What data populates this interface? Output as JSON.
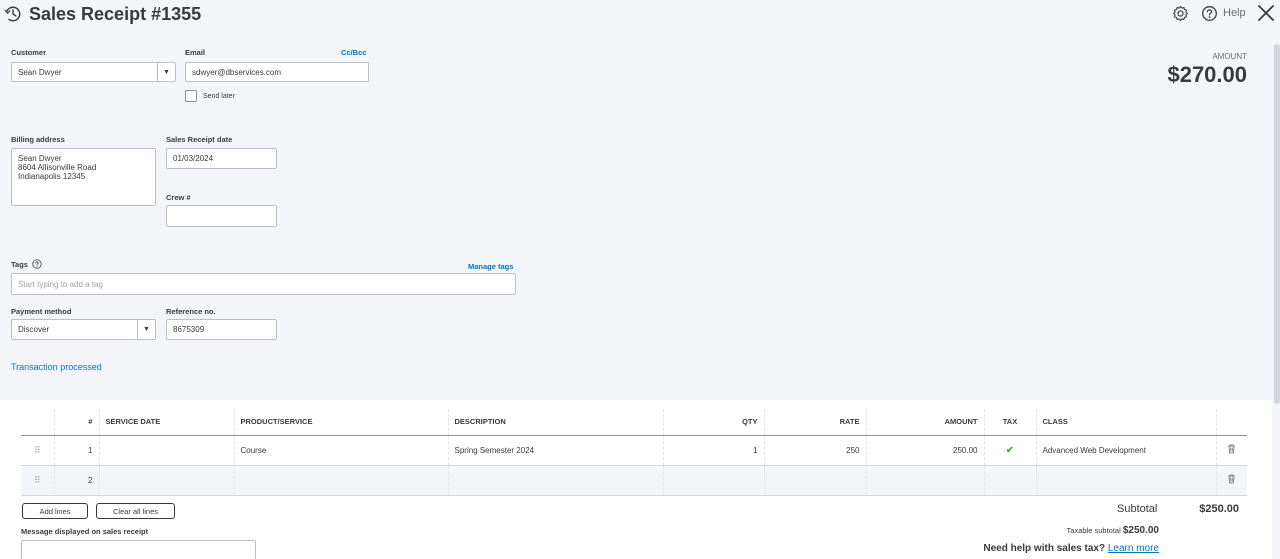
{
  "header": {
    "title": "Sales Receipt #1355",
    "help_label": "Help"
  },
  "form": {
    "customer_label": "Customer",
    "customer_value": "Sean Dwyer",
    "email_label": "Email",
    "cc_bcc_link": "Cc/Bcc",
    "email_value": "sdwyer@dbservices.com",
    "send_later_label": "Send later",
    "billing_address_label": "Billing address",
    "billing_address_lines": [
      "Sean Dwyer",
      "8604 Allisonville Road",
      "Indianapolis  12345"
    ],
    "sales_receipt_date_label": "Sales Receipt date",
    "sales_receipt_date_value": "01/03/2024",
    "crew_label": "Crew #",
    "crew_value": "",
    "tags_label": "Tags",
    "manage_tags_link": "Manage tags",
    "tags_placeholder": "Start typing to add a tag",
    "payment_method_label": "Payment method",
    "payment_method_value": "Discover",
    "reference_label": "Reference no.",
    "reference_value": "8675309",
    "transaction_processed_link": "Transaction processed"
  },
  "amount": {
    "label": "AMOUNT",
    "value": "$270.00"
  },
  "table": {
    "columns": [
      "#",
      "SERVICE DATE",
      "PRODUCT/SERVICE",
      "DESCRIPTION",
      "QTY",
      "RATE",
      "AMOUNT",
      "TAX",
      "CLASS"
    ],
    "rows": [
      {
        "num": "1",
        "service_date": "",
        "product": "Course",
        "description": "Spring Semester 2024",
        "qty": "1",
        "rate": "250",
        "amount": "250.00",
        "tax": "✔",
        "class": "Advanced Web Development"
      },
      {
        "num": "2",
        "service_date": "",
        "product": "",
        "description": "",
        "qty": "",
        "rate": "",
        "amount": "",
        "tax": "",
        "class": ""
      }
    ]
  },
  "footer": {
    "add_lines_button": "Add lines",
    "clear_all_lines_button": "Clear all lines",
    "message_label": "Message displayed on sales receipt",
    "subtotal_label": "Subtotal",
    "subtotal_value": "$250.00",
    "taxable_subtotal_label": "Taxable subtotal",
    "taxable_subtotal_value": "$250.00",
    "need_help_text": "Need help with sales tax?",
    "learn_more_link": "Learn more"
  },
  "icons": {
    "accent": "#0077c5",
    "check_color": "#2ca01c"
  }
}
